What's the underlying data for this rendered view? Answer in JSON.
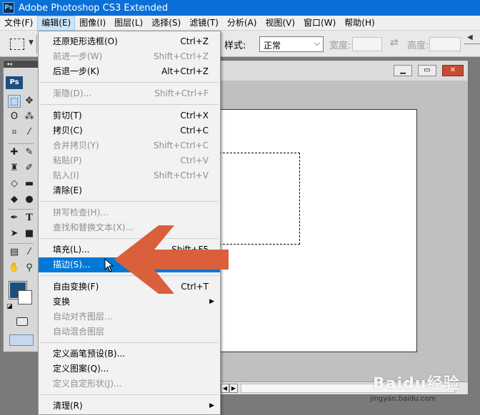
{
  "app": {
    "title": "Adobe Photoshop CS3 Extended",
    "logo_text": "Ps"
  },
  "menubar": [
    {
      "label": "文件(F)"
    },
    {
      "label": "编辑(E)",
      "active": true
    },
    {
      "label": "图像(I)"
    },
    {
      "label": "图层(L)"
    },
    {
      "label": "选择(S)"
    },
    {
      "label": "滤镜(T)"
    },
    {
      "label": "分析(A)"
    },
    {
      "label": "视图(V)"
    },
    {
      "label": "窗口(W)"
    },
    {
      "label": "帮助(H)"
    }
  ],
  "options_bar": {
    "style_label": "样式:",
    "style_value": "正常",
    "width_label": "宽度:",
    "height_label": "高度:"
  },
  "toolbox": {
    "header": "Ps"
  },
  "edit_menu": [
    {
      "label": "还原矩形选框(O)",
      "shortcut": "Ctrl+Z",
      "enabled": true
    },
    {
      "label": "前进一步(W)",
      "shortcut": "Shift+Ctrl+Z",
      "enabled": false
    },
    {
      "label": "后退一步(K)",
      "shortcut": "Alt+Ctrl+Z",
      "enabled": true
    },
    {
      "separator": true
    },
    {
      "label": "渐隐(D)...",
      "shortcut": "Shift+Ctrl+F",
      "enabled": false
    },
    {
      "separator": true
    },
    {
      "label": "剪切(T)",
      "shortcut": "Ctrl+X",
      "enabled": true
    },
    {
      "label": "拷贝(C)",
      "shortcut": "Ctrl+C",
      "enabled": true
    },
    {
      "label": "合并拷贝(Y)",
      "shortcut": "Shift+Ctrl+C",
      "enabled": false
    },
    {
      "label": "粘贴(P)",
      "shortcut": "Ctrl+V",
      "enabled": false
    },
    {
      "label": "贴入(I)",
      "shortcut": "Shift+Ctrl+V",
      "enabled": false
    },
    {
      "label": "清除(E)",
      "shortcut": "",
      "enabled": true
    },
    {
      "separator": true
    },
    {
      "label": "拼写检查(H)...",
      "shortcut": "",
      "enabled": false
    },
    {
      "label": "查找和替换文本(X)...",
      "shortcut": "",
      "enabled": false
    },
    {
      "separator": true
    },
    {
      "label": "填充(L)...",
      "shortcut": "Shift+F5",
      "enabled": true
    },
    {
      "label": "描边(S)...",
      "shortcut": "",
      "enabled": true,
      "highlighted": true
    },
    {
      "separator": true
    },
    {
      "label": "自由变换(F)",
      "shortcut": "Ctrl+T",
      "enabled": true
    },
    {
      "label": "变换",
      "shortcut": "",
      "enabled": true,
      "submenu": true
    },
    {
      "label": "自动对齐图层...",
      "shortcut": "",
      "enabled": false
    },
    {
      "label": "自动混合图层",
      "shortcut": "",
      "enabled": false
    },
    {
      "separator": true
    },
    {
      "label": "定义画笔预设(B)...",
      "shortcut": "",
      "enabled": true
    },
    {
      "label": "定义图案(Q)...",
      "shortcut": "",
      "enabled": true
    },
    {
      "label": "定义自定形状(J)...",
      "shortcut": "",
      "enabled": false
    },
    {
      "separator": true
    },
    {
      "label": "清理(R)",
      "shortcut": "",
      "enabled": true,
      "submenu": true
    }
  ],
  "annotation": {
    "color": "#d9603b"
  },
  "watermark": {
    "name": "Baidu经验",
    "url": "jingyan.baidu.com"
  },
  "colors": {
    "title_bar": "#0a6fd6",
    "menu_highlight": "#0078d7",
    "foreground_swatch": "#1f4d7c"
  }
}
